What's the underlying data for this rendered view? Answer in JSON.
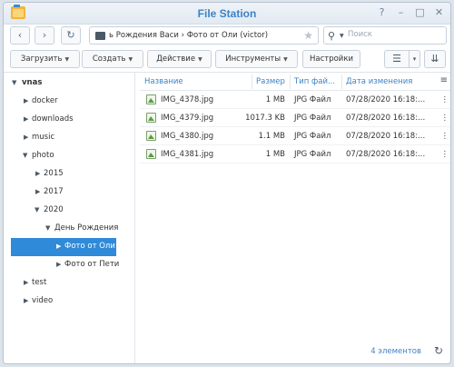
{
  "window": {
    "title": "File Station",
    "controls": {
      "help": "?",
      "minimize": "–",
      "maximize": "□",
      "close": "✕"
    }
  },
  "nav": {
    "back": "‹",
    "forward": "›",
    "refresh": "↻",
    "path": "ь Рождения Васи  ›  Фото от Оли (victor)",
    "star": "★",
    "search_placeholder": "Поиск"
  },
  "toolbar": {
    "upload": "Загрузить",
    "create": "Создать",
    "action": "Действие",
    "tools": "Инструменты",
    "settings": "Настройки",
    "list_view": "☰",
    "view_caret": "▾",
    "sort": "⇊"
  },
  "tree": [
    {
      "label": "vnas",
      "arrow": "▼",
      "bold": true
    },
    {
      "label": "docker",
      "arrow": "▶"
    },
    {
      "label": "downloads",
      "arrow": "▶"
    },
    {
      "label": "music",
      "arrow": "▶"
    },
    {
      "label": "photo",
      "arrow": "▼"
    },
    {
      "label": "2015",
      "arrow": "▶"
    },
    {
      "label": "2017",
      "arrow": "▶"
    },
    {
      "label": "2020",
      "arrow": "▼"
    },
    {
      "label": "День Рождения",
      "arrow": "▼"
    },
    {
      "label": "Фото от Оли",
      "arrow": "▶",
      "selected": true
    },
    {
      "label": "Фото от Пети",
      "arrow": "▶"
    },
    {
      "label": "test",
      "arrow": "▶"
    },
    {
      "label": "video",
      "arrow": "▶"
    }
  ],
  "files": {
    "columns": {
      "name": "Название",
      "size": "Размер",
      "type": "Тип фай...",
      "modified": "Дата изменения",
      "menu": "≡"
    },
    "rows": [
      {
        "name": "IMG_4378.jpg",
        "size": "1 MB",
        "type": "JPG Файл",
        "modified": "07/28/2020 16:18:..."
      },
      {
        "name": "IMG_4379.jpg",
        "size": "1017.3 KB",
        "type": "JPG Файл",
        "modified": "07/28/2020 16:18:..."
      },
      {
        "name": "IMG_4380.jpg",
        "size": "1.1 MB",
        "type": "JPG Файл",
        "modified": "07/28/2020 16:18:..."
      },
      {
        "name": "IMG_4381.jpg",
        "size": "1 MB",
        "type": "JPG Файл",
        "modified": "07/28/2020 16:18:..."
      }
    ],
    "row_more": "⋮"
  },
  "status": {
    "count": "4 элементов",
    "refresh": "↻"
  },
  "colors": {
    "accent": "#3c83c7",
    "selection": "#2f8ad9"
  }
}
